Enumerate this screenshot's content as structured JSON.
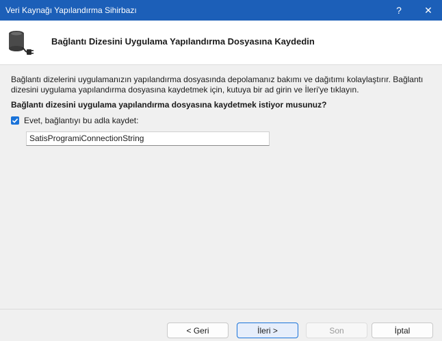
{
  "window": {
    "title": "Veri Kaynağı Yapılandırma Sihirbazı",
    "help_glyph": "?",
    "close_glyph": "✕"
  },
  "header": {
    "icon": "database-plug-icon",
    "title": "Bağlantı Dizesini Uygulama Yapılandırma Dosyasına Kaydedin"
  },
  "main": {
    "description": "Bağlantı dizelerini uygulamanızın yapılandırma dosyasında depolamanız bakımı ve dağıtımı kolaylaştırır. Bağlantı dizesini uygulama yapılandırma dosyasına kaydetmek için, kutuya bir ad girin ve İleri'ye tıklayın.",
    "question": "Bağlantı dizesini uygulama yapılandırma dosyasına kaydetmek istiyor musunuz?",
    "save_checkbox": {
      "label": "Evet, bağlantıyı bu adla kaydet:",
      "checked": true
    },
    "connection_name": "SatisProgramiConnectionString"
  },
  "footer": {
    "back_label": "< Geri",
    "next_label": "İleri >",
    "finish_label": "Son",
    "cancel_label": "İptal"
  },
  "colors": {
    "titlebar": "#1c5fb8",
    "accent": "#1a73d9"
  }
}
